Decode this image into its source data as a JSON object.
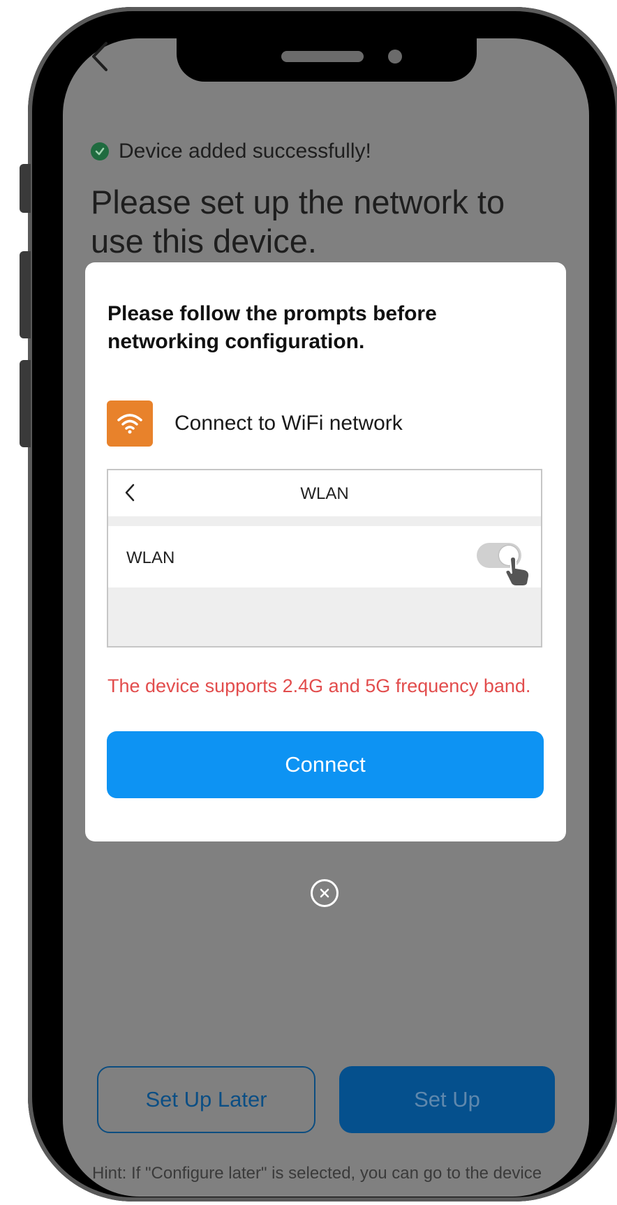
{
  "status": {
    "icon": "check-circle-icon",
    "text": "Device added successfully!"
  },
  "headline": "Please set up the network to use this device.",
  "modal": {
    "title": "Please follow the prompts before networking configuration.",
    "step": {
      "icon": "wifi-icon",
      "label": "Connect to WiFi network"
    },
    "preview": {
      "back_icon": "chevron-left-icon",
      "title": "WLAN",
      "row_label": "WLAN",
      "toggle_on": true
    },
    "notice": "The device supports 2.4G and 5G frequency band.",
    "connect_label": "Connect"
  },
  "close_icon": "close-circle-icon",
  "footer": {
    "later_label": "Set Up Later",
    "setup_label": "Set Up",
    "hint": "Hint: If \"Configure later\" is selected, you can go to the device"
  },
  "colors": {
    "accent": "#0d93f3",
    "warning": "#e24d4d",
    "wifi_tile": "#e8822b",
    "overlay": "#808080"
  }
}
